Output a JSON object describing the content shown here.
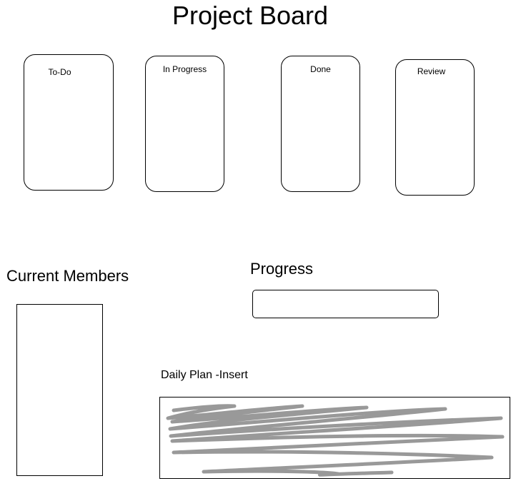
{
  "page": {
    "title": "Project Board"
  },
  "board": {
    "columns": [
      {
        "label": "To-Do"
      },
      {
        "label": "In Progress"
      },
      {
        "label": "Done"
      },
      {
        "label": "Review"
      }
    ]
  },
  "members": {
    "heading": "Current Members"
  },
  "progress": {
    "heading": "Progress"
  },
  "daily_plan": {
    "label": "Daily Plan -Insert"
  },
  "colors": {
    "scribble": "#999999"
  }
}
